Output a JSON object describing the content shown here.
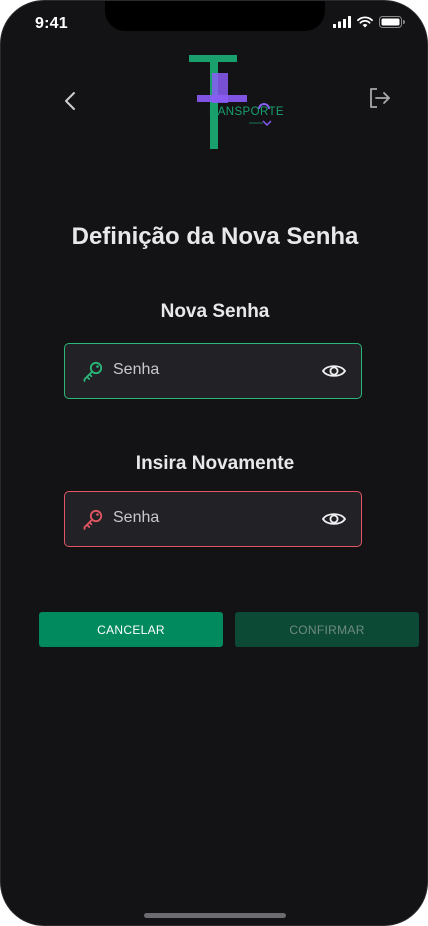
{
  "status_bar": {
    "time": "9:41"
  },
  "logo": {
    "text": "RANSPORTE",
    "colors": {
      "green": "#19a06c",
      "purple": "#8b5cf6"
    }
  },
  "header": {
    "back_icon": "chevron-left-icon",
    "logout_icon": "logout-icon"
  },
  "page": {
    "title": "Definição da Nova Senha"
  },
  "fields": [
    {
      "label": "Nova Senha",
      "placeholder": "Senha",
      "state": "valid",
      "color": "#2bb67a"
    },
    {
      "label": "Insira Novamente",
      "placeholder": "Senha",
      "state": "error",
      "color": "#e25563"
    }
  ],
  "buttons": {
    "cancel": "CANCELAR",
    "confirm": "CONFIRMAR"
  },
  "colors": {
    "background": "#131316",
    "primary": "#008a5e",
    "disabled": "#0c4a36"
  }
}
